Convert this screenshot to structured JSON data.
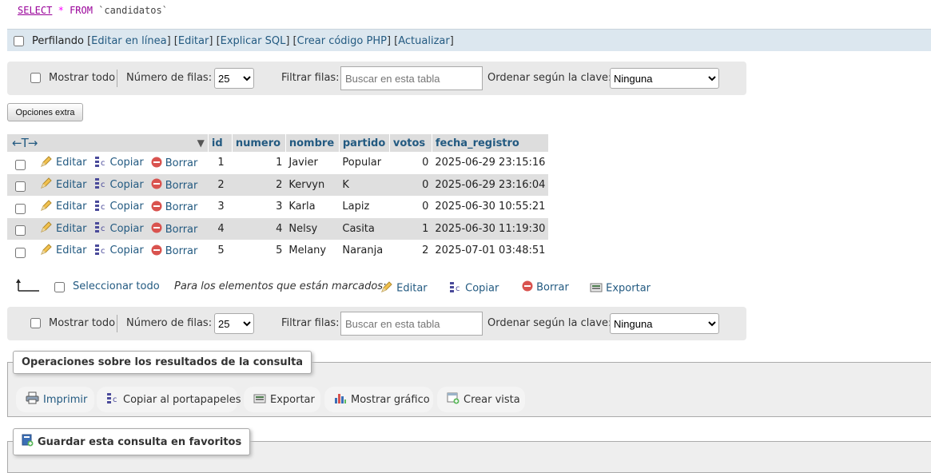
{
  "sql": {
    "keyword_select": "SELECT",
    "star": "*",
    "keyword_from": "FROM",
    "table": "`candidatos`"
  },
  "profiling": {
    "label": "Perfilando",
    "links": [
      "Editar en línea",
      "Editar",
      "Explicar SQL",
      "Crear código PHP",
      "Actualizar"
    ]
  },
  "nav": {
    "show_all": "Mostrar todo",
    "rows_label": "Número de filas:",
    "rows_value": "25",
    "filter_label": "Filtrar filas:",
    "search_placeholder": "Buscar en esta tabla",
    "sort_label": "Ordenar según la clave:",
    "sort_value": "Ninguna"
  },
  "extra_options": "Opciones extra",
  "table": {
    "columns": [
      "id",
      "numero",
      "nombre",
      "partido",
      "votos",
      "fecha_registro"
    ],
    "actions": {
      "edit": "Editar",
      "copy": "Copiar",
      "delete": "Borrar"
    },
    "rows": [
      {
        "id": "1",
        "numero": "1",
        "nombre": "Javier",
        "partido": "Popular",
        "votos": "0",
        "fecha_registro": "2025-06-29 23:15:16"
      },
      {
        "id": "2",
        "numero": "2",
        "nombre": "Kervyn",
        "partido": "K",
        "votos": "0",
        "fecha_registro": "2025-06-29 23:16:04"
      },
      {
        "id": "3",
        "numero": "3",
        "nombre": "Karla",
        "partido": "Lapiz",
        "votos": "0",
        "fecha_registro": "2025-06-30 10:55:21"
      },
      {
        "id": "4",
        "numero": "4",
        "nombre": "Nelsy",
        "partido": "Casita",
        "votos": "1",
        "fecha_registro": "2025-06-30 11:19:30"
      },
      {
        "id": "5",
        "numero": "5",
        "nombre": "Melany",
        "partido": "Naranja",
        "votos": "2",
        "fecha_registro": "2025-07-01 03:48:51"
      }
    ]
  },
  "marked": {
    "select_all": "Seleccionar todo",
    "for_marked": "Para los elementos que están marcados:",
    "edit": "Editar",
    "copy": "Copiar",
    "delete": "Borrar",
    "export": "Exportar"
  },
  "operations": {
    "title": "Operaciones sobre los resultados de la consulta",
    "print": "Imprimir",
    "copy_clipboard": "Copiar al portapapeles",
    "export": "Exportar",
    "chart": "Mostrar gráfico",
    "create_view": "Crear vista"
  },
  "bookmark": {
    "title": "Guardar esta consulta en favoritos"
  },
  "colors": {
    "link": "#235a81",
    "profbar": "#dce7ef",
    "navbar": "#e9e9e9",
    "row_even": "#dfdfdf",
    "delete_red": "#d9534f"
  }
}
